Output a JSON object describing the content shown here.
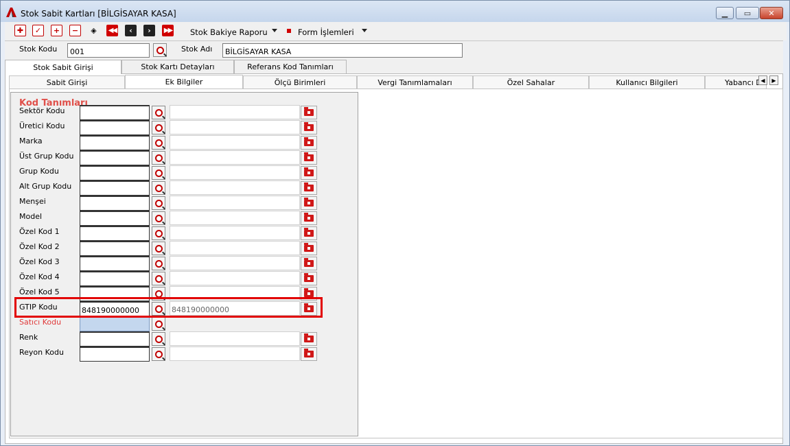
{
  "window": {
    "title": "Stok Sabit Kartları [BİLGİSAYAR KASA]",
    "controls": [
      "minimize",
      "maximize",
      "close"
    ]
  },
  "toolbar": {
    "icons": [
      "new-icon",
      "save-icon",
      "add-icon",
      "delete-icon",
      "erase-icon",
      "first-icon",
      "prev-icon",
      "next-icon",
      "last-icon"
    ],
    "menu1_label": "Stok Bakiye Raporu",
    "menu2_label": "Form İşlemleri"
  },
  "header": {
    "stok_kodu_label": "Stok Kodu",
    "stok_kodu_value": "001",
    "stok_adi_label": "Stok Adı",
    "stok_adi_value": "BİLGİSAYAR KASA"
  },
  "tabs_main": [
    {
      "label": "Stok Sabit Girişi",
      "active": true
    },
    {
      "label": "Stok Kartı Detayları",
      "active": false
    },
    {
      "label": "Referans Kod Tanımları",
      "active": false
    }
  ],
  "tabs_sub": [
    {
      "label": "Sabit Girişi",
      "active": false
    },
    {
      "label": "Ek Bilgiler",
      "active": true
    },
    {
      "label": "Ölçü Birimleri",
      "active": false
    },
    {
      "label": "Vergi Tanımlamaları",
      "active": false
    },
    {
      "label": "Özel Sahalar",
      "active": false
    },
    {
      "label": "Kullanıcı Bilgileri",
      "active": false
    },
    {
      "label": "Yabancı D",
      "active": false
    }
  ],
  "kod": {
    "title": "Kod Tanımları",
    "rows": [
      {
        "label": "Sektör Kodu",
        "value": "",
        "desc": ""
      },
      {
        "label": "Üretici Kodu",
        "value": "",
        "desc": ""
      },
      {
        "label": "Marka",
        "value": "",
        "desc": ""
      },
      {
        "label": "Üst Grup Kodu",
        "value": "",
        "desc": ""
      },
      {
        "label": "Grup Kodu",
        "value": "",
        "desc": ""
      },
      {
        "label": "Alt Grup Kodu",
        "value": "",
        "desc": ""
      },
      {
        "label": "Menşei",
        "value": "",
        "desc": ""
      },
      {
        "label": "Model",
        "value": "",
        "desc": ""
      },
      {
        "label": "Özel Kod 1",
        "value": "",
        "desc": ""
      },
      {
        "label": "Özel Kod 2",
        "value": "",
        "desc": ""
      },
      {
        "label": "Özel Kod 3",
        "value": "",
        "desc": ""
      },
      {
        "label": "Özel Kod 4",
        "value": "",
        "desc": ""
      },
      {
        "label": "Özel Kod 5",
        "value": "",
        "desc": ""
      },
      {
        "label": "GTIP Kodu",
        "value": "848190000000",
        "desc": "848190000000"
      },
      {
        "label": "Satıcı Kodu",
        "value": "",
        "desc": ""
      },
      {
        "label": "Renk",
        "value": "",
        "desc": ""
      },
      {
        "label": "Reyon Kodu",
        "value": "",
        "desc": ""
      }
    ]
  },
  "colors": {
    "accent_red": "#e20000",
    "title_red": "#e0504a",
    "selected_field": "#c4d7ee"
  }
}
